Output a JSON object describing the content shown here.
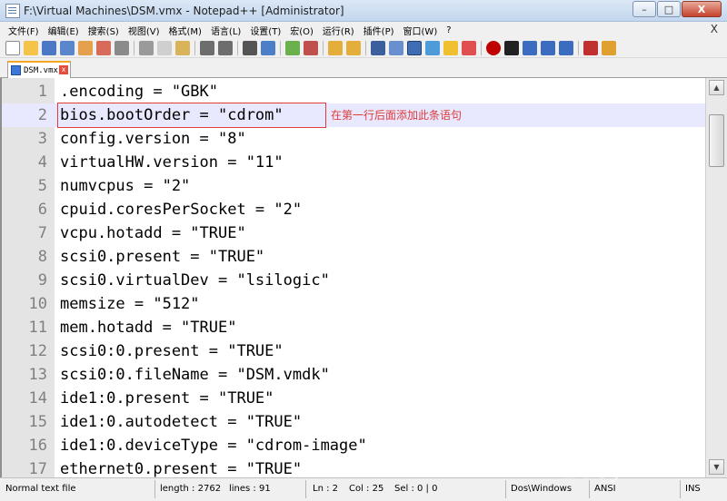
{
  "window": {
    "title": "F:\\Virtual Machines\\DSM.vmx - Notepad++ [Administrator]",
    "minimize": "–",
    "maximize": "□",
    "close": "X"
  },
  "menu": {
    "items": [
      "文件(F)",
      "编辑(E)",
      "搜索(S)",
      "视图(V)",
      "格式(M)",
      "语言(L)",
      "设置(T)",
      "宏(O)",
      "运行(R)",
      "插件(P)",
      "窗口(W)",
      "?"
    ],
    "close": "X"
  },
  "tab": {
    "label": "DSM.vmx",
    "close": "x"
  },
  "editor": {
    "lines": [
      {
        "num": "1",
        "text": ".encoding = \"GBK\""
      },
      {
        "num": "2",
        "text": "bios.bootOrder = \"cdrom\""
      },
      {
        "num": "3",
        "text": "config.version = \"8\""
      },
      {
        "num": "4",
        "text": "virtualHW.version = \"11\""
      },
      {
        "num": "5",
        "text": "numvcpus = \"2\""
      },
      {
        "num": "6",
        "text": "cpuid.coresPerSocket = \"2\""
      },
      {
        "num": "7",
        "text": "vcpu.hotadd = \"TRUE\""
      },
      {
        "num": "8",
        "text": "scsi0.present = \"TRUE\""
      },
      {
        "num": "9",
        "text": "scsi0.virtualDev = \"lsilogic\""
      },
      {
        "num": "10",
        "text": "memsize = \"512\""
      },
      {
        "num": "11",
        "text": "mem.hotadd = \"TRUE\""
      },
      {
        "num": "12",
        "text": "scsi0:0.present = \"TRUE\""
      },
      {
        "num": "13",
        "text": "scsi0:0.fileName = \"DSM.vmdk\""
      },
      {
        "num": "14",
        "text": "ide1:0.present = \"TRUE\""
      },
      {
        "num": "15",
        "text": "ide1:0.autodetect = \"TRUE\""
      },
      {
        "num": "16",
        "text": "ide1:0.deviceType = \"cdrom-image\""
      },
      {
        "num": "17",
        "text": "ethernet0.present = \"TRUE\""
      }
    ],
    "annotation": "在第一行后面添加此条语句"
  },
  "status": {
    "file_type": "Normal text file",
    "length": "length : 2762",
    "lines": "lines : 91",
    "ln": "Ln : 2",
    "col": "Col : 25",
    "sel": "Sel : 0 | 0",
    "eol": "Dos\\Windows",
    "encoding": "ANSI",
    "mode": "INS"
  },
  "watermark": "Easy..."
}
